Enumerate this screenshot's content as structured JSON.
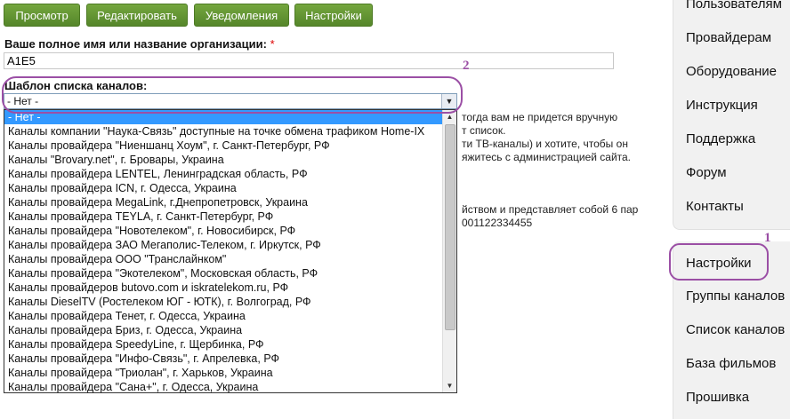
{
  "tabs": [
    {
      "label": "Просмотр"
    },
    {
      "label": "Редактировать"
    },
    {
      "label": "Уведомления"
    },
    {
      "label": "Настройки"
    }
  ],
  "form": {
    "name_label": "Ваше полное имя или название организации:",
    "required_mark": "*",
    "name_value": "A1E5",
    "template_label": "Шаблон списка каналов:",
    "select_value": "- Нет -",
    "options": [
      "- Нет -",
      "Каналы компании \"Наука-Связь\" доступные на точке обмена трафиком Home-IX",
      "Каналы провайдера \"Ниеншанц Хоум\", г. Санкт-Петербург, РФ",
      "Каналы \"Brovary.net\", г. Бровары, Украина",
      "Каналы провайдера LENTEL, Ленинградская область, РФ",
      "Каналы провайдера ICN, г. Одесса, Украина",
      "Каналы провайдера MegaLink, г.Днепропетровск, Украина",
      "Каналы провайдера TEYLA, г. Санкт-Петербург, РФ",
      "Каналы провайдера \"Новотелеком\", г. Новосибирск, РФ",
      "Каналы провайдера ЗАО Мегаполис-Телеком, г. Иркутск, РФ",
      "Каналы провайдера ООО \"Транслайнком\"",
      "Каналы провайдера \"Экотелеком\", Московская область, РФ",
      "Каналы провайдеров butovo.com и iskratelekom.ru, РФ",
      "Каналы DieselTV (Ростелеком ЮГ - ЮТК), г. Волгоград, РФ",
      "Каналы провайдера Тенет, г. Одесса, Украина",
      "Каналы провайдера Бриз, г. Одесса, Украина",
      "Каналы провайдера SpeedyLine, г. Щербинка, РФ",
      "Каналы провайдера \"Инфо-Связь\", г. Апрелевка, РФ",
      "Каналы провайдера \"Триолан\", г. Харьков, Украина",
      "Каналы провайдера \"Сана+\", г. Одесса, Украина"
    ]
  },
  "background_text": [
    "тогда вам не придется вручную",
    "т список.",
    "ти ТВ-каналы) и хотите, чтобы он",
    "яжитесь с администрацией сайта.",
    "йством и представляет собой 6 пар",
    "001122334455"
  ],
  "sidebar": {
    "top_items": [
      "Пользователям",
      "Провайдерам",
      "Оборудование",
      "Инструкция",
      "Поддержка",
      "Форум",
      "Контакты"
    ],
    "bottom_items": [
      "Настройки",
      "Группы каналов",
      "Список каналов",
      "База фильмов",
      "Прошивка"
    ]
  },
  "annotations": {
    "marker_1": "1",
    "marker_2": "2",
    "color": "#9b4fa5"
  }
}
